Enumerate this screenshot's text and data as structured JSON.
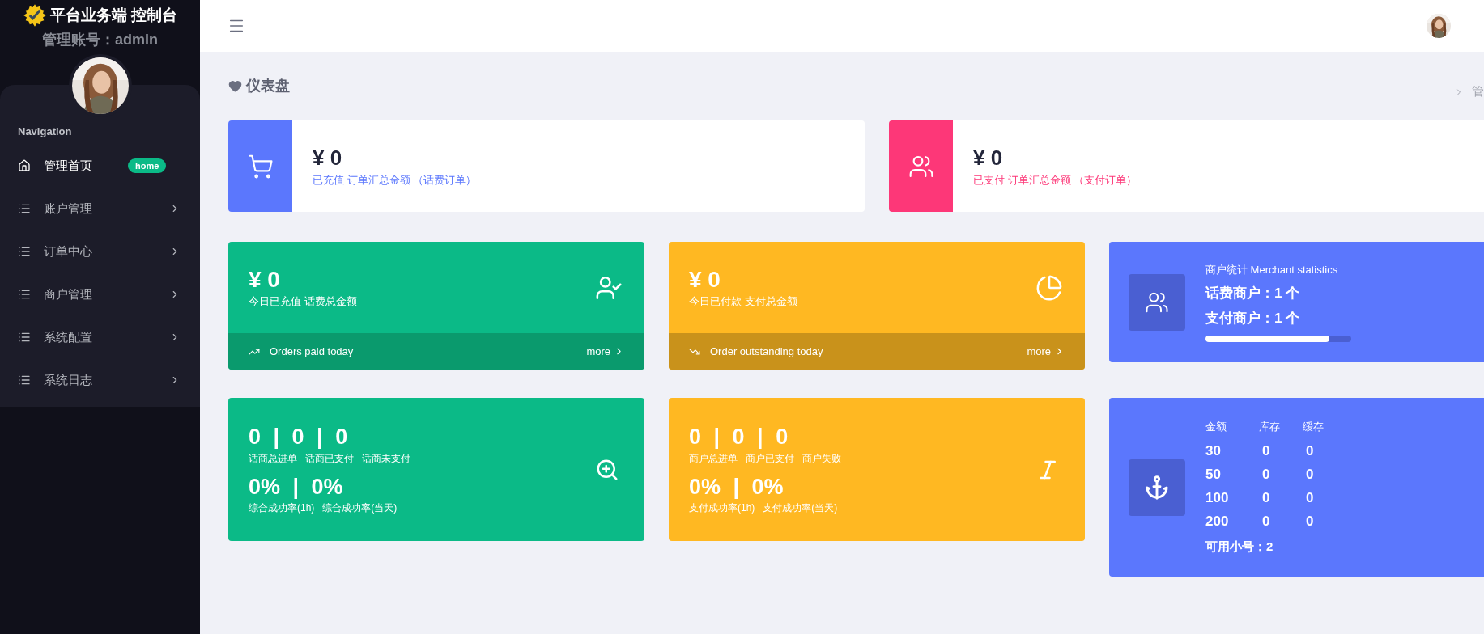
{
  "sidebar": {
    "title": "平台业务端 控制台",
    "account": "管理账号：admin",
    "section": "Navigation",
    "items": [
      {
        "label": "管理首页",
        "badge": "home",
        "kind": "home",
        "selected": true
      },
      {
        "label": "账户管理",
        "kind": "menu",
        "selected": false
      },
      {
        "label": "订单中心",
        "kind": "menu",
        "selected": false
      },
      {
        "label": "商户管理",
        "kind": "menu",
        "selected": false
      },
      {
        "label": "系统配置",
        "kind": "menu",
        "selected": false
      },
      {
        "label": "系统日志",
        "kind": "menu",
        "selected": false
      }
    ]
  },
  "header": {
    "breadcrumb": "管"
  },
  "page_title": "仪表盘",
  "summary_cards": [
    {
      "amount": "¥ 0",
      "caption": "已充值 订单汇总金额 （话费订单）",
      "color": "#5b77fd"
    },
    {
      "amount": "¥ 0",
      "caption": "已支付 订单汇总金额 （支付订单）",
      "color": "#fd3778"
    }
  ],
  "stat_cards": [
    {
      "amount": "¥ 0",
      "caption": "今日已充值 话费总金额",
      "footer": "Orders paid today",
      "more": "more",
      "color": "#0bba87"
    },
    {
      "amount": "¥ 0",
      "caption": "今日已付款 支付总金额",
      "footer": "Order outstanding today",
      "more": "more",
      "color": "#ffb822"
    }
  ],
  "merchant_card": {
    "title": "商户统计 Merchant statistics",
    "lines": [
      "话费商户：1 个",
      "支付商户：1 个"
    ],
    "level": 0.85
  },
  "totals_cards": [
    {
      "counts": "0 | 0 | 0",
      "count_labels": [
        "话商总进单",
        "话商已支付",
        "话商未支付"
      ],
      "rates": "0% | 0%",
      "rate_labels": [
        "综合成功率(1h)",
        "综合成功率(当天)"
      ],
      "color": "#0bba87"
    },
    {
      "counts": "0 | 0 | 0",
      "count_labels": [
        "商户总进单",
        "商户已支付",
        "商户失败"
      ],
      "rates": "0% | 0%",
      "rate_labels": [
        "支付成功率(1h)",
        "支付成功率(当天)"
      ],
      "color": "#ffb822"
    }
  ],
  "inventory_card": {
    "columns": [
      "金额",
      "库存",
      "缓存"
    ],
    "rows": [
      [
        "30",
        "0",
        "0"
      ],
      [
        "50",
        "0",
        "0"
      ],
      [
        "100",
        "0",
        "0"
      ],
      [
        "200",
        "0",
        "0"
      ]
    ],
    "footer": "可用小号：2"
  }
}
